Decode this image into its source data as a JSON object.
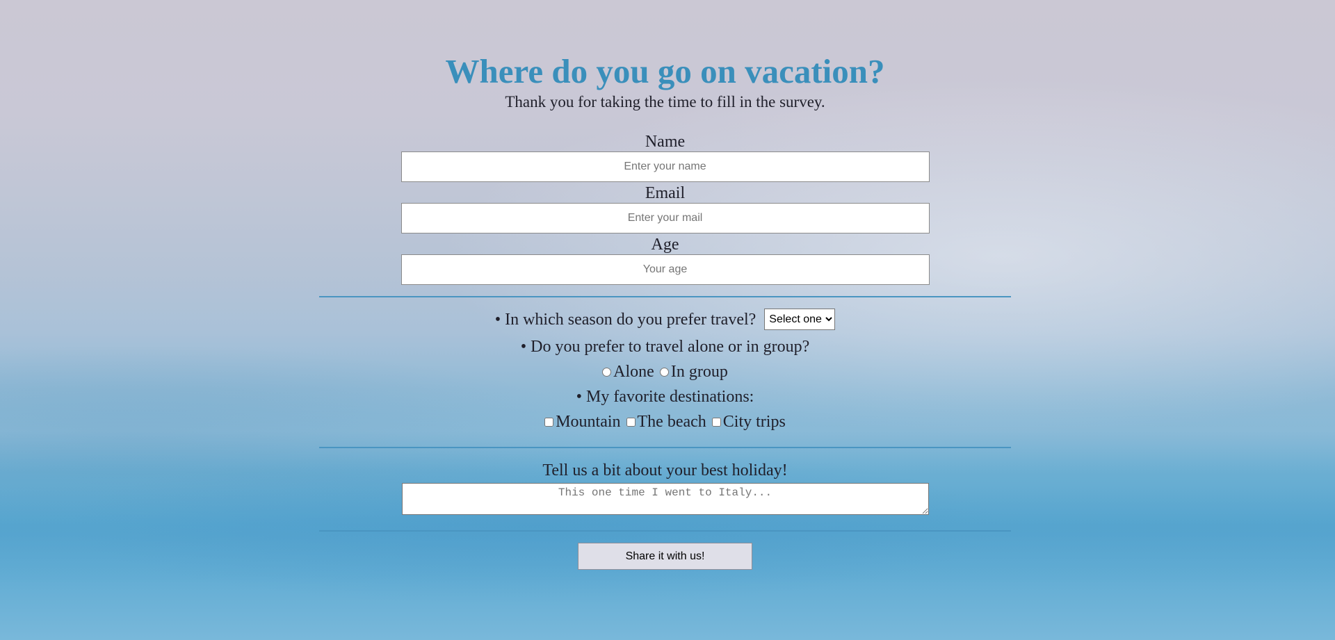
{
  "header": {
    "title": "Where do you go on vacation?",
    "subtitle": "Thank you for taking the time to fill in the survey."
  },
  "form": {
    "name": {
      "label": "Name",
      "placeholder": "Enter your name",
      "value": ""
    },
    "email": {
      "label": "Email",
      "placeholder": "Enter your mail",
      "value": ""
    },
    "age": {
      "label": "Age",
      "placeholder": "Your age",
      "value": ""
    },
    "season": {
      "question": "• In which season do you prefer travel?",
      "selected": "Select one"
    },
    "company": {
      "question": "• Do you prefer to travel alone or in group?",
      "options": [
        "Alone",
        "In group"
      ]
    },
    "destinations": {
      "question": "• My favorite destinations:",
      "options": [
        "Mountain",
        "The beach",
        "City trips"
      ]
    },
    "holiday": {
      "label": "Tell us a bit about your best holiday!",
      "placeholder": "This one time I went to Italy..."
    },
    "submit_label": "Share it with us!"
  },
  "colors": {
    "title": "#3a8fbb",
    "divider": "#4a95c1"
  }
}
